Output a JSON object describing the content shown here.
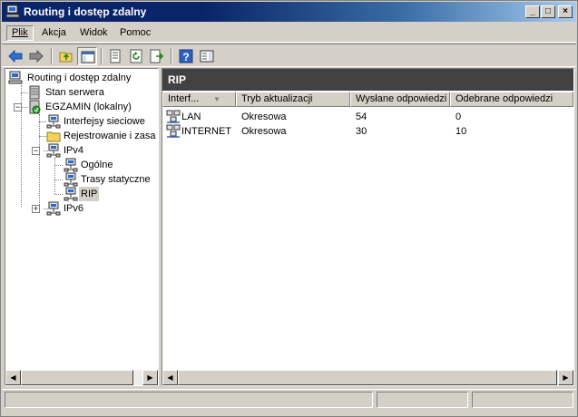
{
  "window": {
    "title": "Routing i dostęp zdalny",
    "buttons": [
      "_",
      "□",
      "×"
    ]
  },
  "menu": [
    {
      "label": "Plik",
      "active": true
    },
    {
      "label": "Akcja"
    },
    {
      "label": "Widok"
    },
    {
      "label": "Pomoc"
    }
  ],
  "toolbar": {
    "icons": [
      "back-arrow-icon",
      "forward-arrow-icon",
      "up-folder-icon",
      "console-tree-icon",
      "properties-icon",
      "refresh-icon",
      "export-list-icon",
      "help-icon",
      "action-pane-icon"
    ]
  },
  "tree": {
    "items": [
      {
        "label": "Routing i dostęp zdalny",
        "icon": "computer-network-icon"
      },
      {
        "label": "Stan serwera",
        "icon": "server-icon"
      },
      {
        "label": "EGZAMIN (lokalny)",
        "icon": "server-green-icon",
        "expander": "−"
      },
      {
        "label": "Interfejsy sieciowe",
        "icon": "network-icon"
      },
      {
        "label": "Rejestrowanie i zasady",
        "icon": "folder-icon"
      },
      {
        "label": "IPv4",
        "icon": "network-icon",
        "expander": "−"
      },
      {
        "label": "Ogólne",
        "icon": "network-icon"
      },
      {
        "label": "Trasy statyczne",
        "icon": "network-icon"
      },
      {
        "label": "RIP",
        "icon": "network-icon",
        "selected": true
      },
      {
        "label": "IPv6",
        "icon": "network-icon",
        "expander": "+"
      }
    ]
  },
  "right_pane": {
    "title": "RIP",
    "columns": [
      "Interf...",
      "Tryb aktualizacji",
      "Wysłane odpowiedzi",
      "Odebrane odpowiedzi"
    ],
    "sort_indicator": "▼",
    "rows": [
      {
        "interface": "LAN",
        "mode": "Okresowa",
        "sent": "54",
        "received": "0"
      },
      {
        "interface": "INTERNET",
        "mode": "Okresowa",
        "sent": "30",
        "received": "10"
      }
    ]
  },
  "scroll_arrows": {
    "left": "◀",
    "right": "▶"
  },
  "colors": {
    "title_start": "#0a246a",
    "title_end": "#a6caf0",
    "pane_header": "#424242",
    "face": "#d4d0c8"
  }
}
